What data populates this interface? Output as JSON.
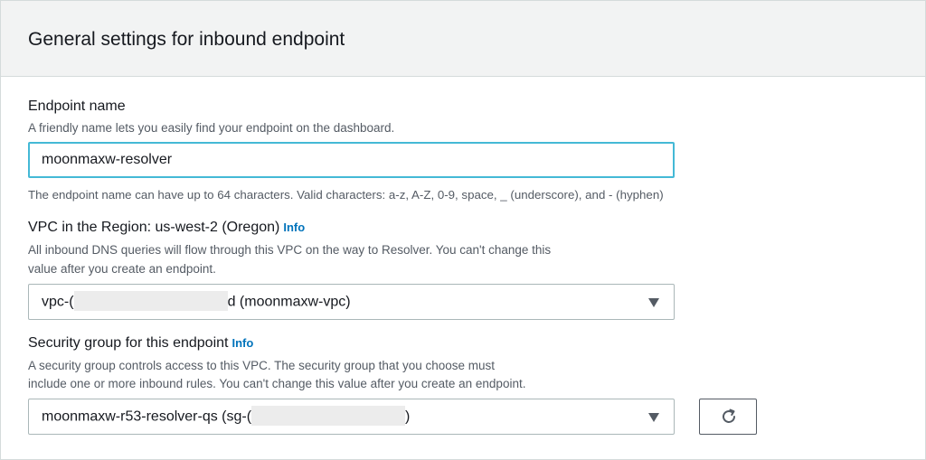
{
  "panel": {
    "title": "General settings for inbound endpoint"
  },
  "endpoint_name": {
    "label": "Endpoint name",
    "description": "A friendly name lets you easily find your endpoint on the dashboard.",
    "value": "moonmaxw-resolver",
    "constraint": "The endpoint name can have up to 64 characters. Valid characters: a-z, A-Z, 0-9, space, _ (underscore), and - (hyphen)"
  },
  "vpc": {
    "label": "VPC in the Region: us-west-2 (Oregon)",
    "info": "Info",
    "description_line1": "All inbound DNS queries will flow through this VPC on the way to Resolver. You can't change this",
    "description_line2": "value after you create an endpoint.",
    "selected_prefix": "vpc-(",
    "selected_suffix": "d (moonmaxw-vpc)",
    "dropdown_icon": "caret-down-icon"
  },
  "security_group": {
    "label": "Security group for this endpoint",
    "info": "Info",
    "description_line1": "A security group controls access to this VPC. The security group that you choose must",
    "description_line2": "include one or more inbound rules. You can't change this value after you create an endpoint.",
    "selected_prefix": "moonmaxw-r53-resolver-qs (sg-(",
    "selected_suffix": ")",
    "dropdown_icon": "caret-down-icon",
    "refresh_icon": "refresh-icon"
  },
  "colors": {
    "header_bg": "#f2f3f3",
    "input_focus_border": "#44b9d6",
    "link": "#0073bb",
    "description_text": "#545b64"
  }
}
